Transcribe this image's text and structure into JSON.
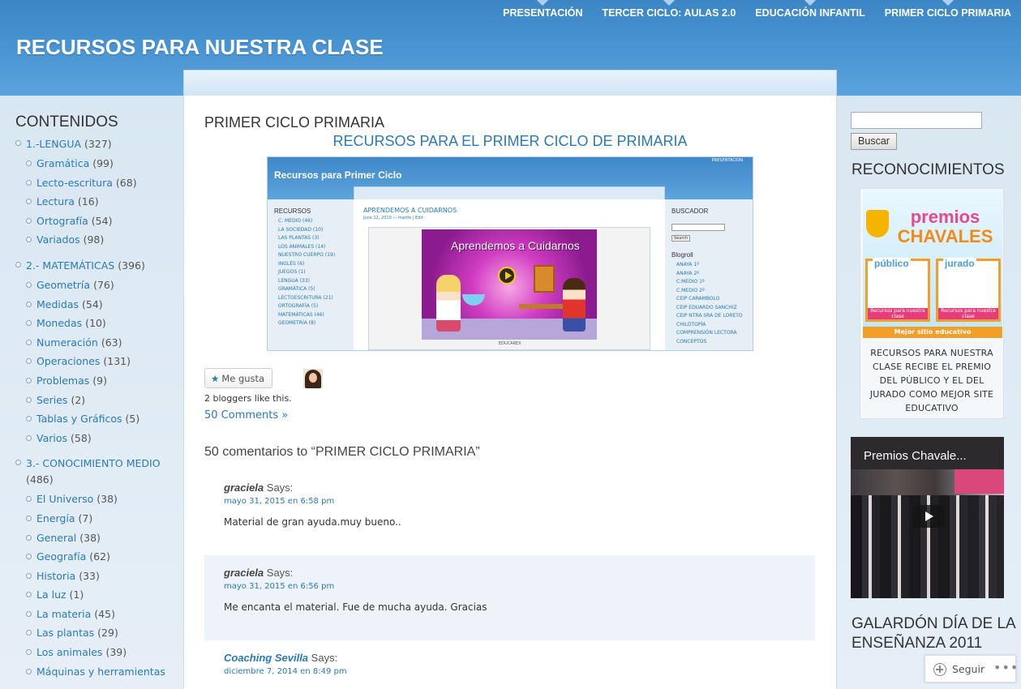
{
  "header": {
    "site_title": "RECURSOS PARA NUESTRA CLASE",
    "nav": [
      "PRESENTACIÓN",
      "TERCER CICLO: AULAS 2.0",
      "EDUCACIÓN INFANTIL",
      "PRIMER CICLO PRIMARIA"
    ]
  },
  "sidebar": {
    "title": "CONTENIDOS",
    "categories": [
      {
        "label": "1.-LENGUA",
        "count": "(327)",
        "items": [
          {
            "label": "Gramática",
            "count": "(99)"
          },
          {
            "label": "Lecto-escritura",
            "count": "(68)"
          },
          {
            "label": "Lectura",
            "count": "(16)"
          },
          {
            "label": "Ortografía",
            "count": "(54)"
          },
          {
            "label": "Variados",
            "count": "(98)"
          }
        ]
      },
      {
        "label": "2.- MATEMÁTICAS",
        "count": "(396)",
        "items": [
          {
            "label": "Geometría",
            "count": "(76)"
          },
          {
            "label": "Medidas",
            "count": "(54)"
          },
          {
            "label": "Monedas",
            "count": "(10)"
          },
          {
            "label": "Numeración",
            "count": "(63)"
          },
          {
            "label": "Operaciones",
            "count": "(131)"
          },
          {
            "label": "Problemas",
            "count": "(9)"
          },
          {
            "label": "Series",
            "count": "(2)"
          },
          {
            "label": "Tablas y Gráficos",
            "count": "(5)"
          },
          {
            "label": "Varios",
            "count": "(58)"
          }
        ]
      },
      {
        "label": "3.- CONOCIMIENTO MEDIO",
        "count": "(486)",
        "items": [
          {
            "label": "El Universo",
            "count": "(38)"
          },
          {
            "label": "Energía",
            "count": "(7)"
          },
          {
            "label": "General",
            "count": "(38)"
          },
          {
            "label": "Geografía",
            "count": "(62)"
          },
          {
            "label": "Historia",
            "count": "(33)"
          },
          {
            "label": "La luz",
            "count": "(1)"
          },
          {
            "label": "La materia",
            "count": "(45)"
          },
          {
            "label": "Las plantas",
            "count": "(29)"
          },
          {
            "label": "Los animales",
            "count": "(39)"
          },
          {
            "label": "Máquinas y herramientas",
            "count": ""
          }
        ]
      }
    ]
  },
  "main": {
    "page_title": "PRIMER CICLO PRIMARIA",
    "subheading": "RECURSOS PARA EL PRIMER CICLO DE PRIMARIA",
    "screenshot": {
      "site_title": "Recursos para Primer Ciclo",
      "top_link": "PRESENTACION",
      "left_heading": "RECURSOS",
      "left_items": [
        "C. MEDIO (46)",
        "LA SOCIEDAD (10)",
        "LAS PLANTAS (3)",
        "LOS ANIMALES (14)",
        "NUESTRO CUERPO (19)",
        "INGLÉS (6)",
        "JUEGOS (1)",
        "LENGUA (33)",
        "GRAMÁTICA (5)",
        "LECTOESCRITURA (21)",
        "ORTOGRAFÍA (5)",
        "MATEMÁTICAS (46)",
        "GEOMETRÍA (8)"
      ],
      "post_title": "APRENDEMOS A CUIDARNOS",
      "post_meta": "June 12, 2010 — marife | Edit",
      "art_title": "Aprendemos a Cuidarnos",
      "caption": "EDUCAREX",
      "right_heading": "BUSCADOR",
      "search_btn": "Search",
      "blogroll_heading": "Blogroll",
      "blogroll": [
        "ANAYA 1º",
        "ANAYA 2º",
        "C.MEDIO 1º",
        "C.MEDIO 2º",
        "CEIP CARAMBOLO",
        "CEIP EDUARDO SANCHIZ",
        "CEIP NTRA SRA DE LORETO",
        "CHILDTOPÍA",
        "COMPRENSIÓN LECTORA",
        "CONCEPTOS"
      ]
    },
    "like_button": "Me gusta",
    "bloggers_like": "2 bloggers like this.",
    "comments_link": "50 Comments »",
    "comments_title": "50 comentarios to “PRIMER CICLO PRIMARIA”",
    "comments": [
      {
        "author": "graciela",
        "says": "Says:",
        "date": "mayo 31, 2015 en 6:58 pm",
        "text": "Material de gran ayuda.muy bueno.."
      },
      {
        "author": "graciela",
        "says": "Says:",
        "date": "mayo 31, 2015 en 6:56 pm",
        "text": "Me encanta el material. Fue de mucha ayuda. Gracias"
      },
      {
        "author": "Coaching Sevilla",
        "says": "Says:",
        "date": "diciembre 7, 2014 en 8:49 pm",
        "text": ""
      }
    ]
  },
  "right": {
    "search_button": "Buscar",
    "search_value": "",
    "recognitions_title": "RECONOCIMIENTOS",
    "award_image": {
      "logo_top": "premios",
      "logo_bottom": "CHAVALES",
      "panel_left": "público",
      "panel_right": "jurado",
      "panel_caption": "Recursos para nuestra clase",
      "bar": "Mejor sitio educativo"
    },
    "award_text": "RECURSOS PARA NUESTRA CLASE RECIBE EL PREMIO DEL PÚBLICO Y EL DEL JURADO COMO MEJOR SITE EDUCATIVO",
    "video_title": "Premios Chavale...",
    "galardon_title": "GALARDÓN DÍA DE LA ENSEÑANZA 2011"
  },
  "follow": {
    "label": "Seguir",
    "more": "•••"
  },
  "colors": {
    "link": "#2a7ab7",
    "header": "#4a95d3",
    "comment_alt_bg": "#edf3f9"
  }
}
